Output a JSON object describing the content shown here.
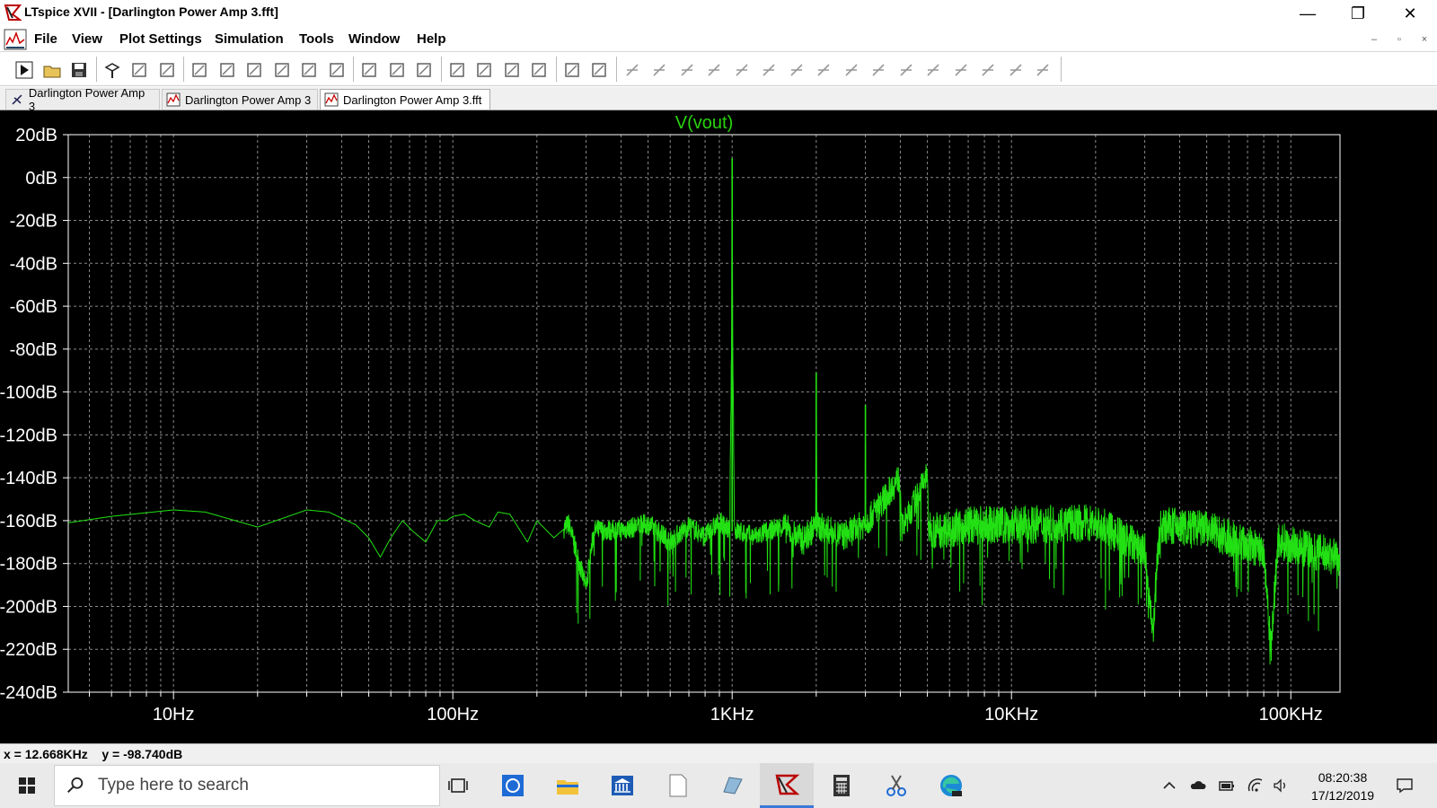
{
  "window": {
    "title": "LTspice XVII - [Darlington Power Amp 3.fft]",
    "buttons": {
      "minimize": "—",
      "maximize": "❐",
      "close": "✕"
    }
  },
  "menu": {
    "items": [
      "File",
      "View",
      "Plot Settings",
      "Simulation",
      "Tools",
      "Window",
      "Help"
    ],
    "mdi_buttons": {
      "minimize": "–",
      "restore": "▫",
      "close": "×"
    }
  },
  "toolbar": {
    "icons": [
      "run-icon",
      "open-icon",
      "save-icon",
      "control-panel-icon",
      "halt-icon",
      "pan-icon",
      "zoom-in-icon",
      "zoom-full-icon",
      "zoom-out-icon",
      "zoom-cancel-icon",
      "autorange-icon",
      "manual-limits-icon",
      "tile-horizontal-icon",
      "cascade-icon",
      "tile-vertical-icon",
      "cut-icon",
      "copy-icon",
      "paste-icon",
      "find-icon",
      "print-icon",
      "print-preview-icon",
      "draw-wire-icon",
      "ground-icon",
      "label-net-icon",
      "resistor-icon",
      "capacitor-icon",
      "inductor-icon",
      "diode-icon",
      "component-icon",
      "move-icon",
      "drag-icon",
      "undo-icon",
      "redo-icon",
      "rotate-icon",
      "mirror-icon",
      "text-icon",
      "spice-directive-icon"
    ]
  },
  "tabs": [
    {
      "label": "Darlington Power Amp 3",
      "icon": "schematic-icon",
      "active": false
    },
    {
      "label": "Darlington Power Amp 3",
      "icon": "waveform-icon",
      "active": false
    },
    {
      "label": "Darlington Power Amp 3.fft",
      "icon": "waveform-icon",
      "active": true
    }
  ],
  "plot": {
    "background": "#000000",
    "trace_color": "#22e013",
    "grid_color": "#8a8a8a"
  },
  "chart_data": {
    "type": "line",
    "title": "V(vout)",
    "xlabel": "",
    "ylabel": "",
    "x_scale": "log",
    "xlim": [
      4.2,
      150000
    ],
    "ylim": [
      -240,
      20
    ],
    "grid": true,
    "x_ticks": [
      {
        "value": 10,
        "label": "10Hz"
      },
      {
        "value": 100,
        "label": "100Hz"
      },
      {
        "value": 1000,
        "label": "1KHz"
      },
      {
        "value": 10000,
        "label": "10KHz"
      },
      {
        "value": 100000,
        "label": "100KHz"
      }
    ],
    "y_ticks": [
      {
        "value": 20,
        "label": "20dB"
      },
      {
        "value": 0,
        "label": "0dB"
      },
      {
        "value": -20,
        "label": "-20dB"
      },
      {
        "value": -40,
        "label": "-40dB"
      },
      {
        "value": -60,
        "label": "-60dB"
      },
      {
        "value": -80,
        "label": "-80dB"
      },
      {
        "value": -100,
        "label": "-100dB"
      },
      {
        "value": -120,
        "label": "-120dB"
      },
      {
        "value": -140,
        "label": "-140dB"
      },
      {
        "value": -160,
        "label": "-160dB"
      },
      {
        "value": -180,
        "label": "-180dB"
      },
      {
        "value": -200,
        "label": "-200dB"
      },
      {
        "value": -220,
        "label": "-220dB"
      },
      {
        "value": -240,
        "label": "-240dB"
      }
    ],
    "series": [
      {
        "name": "V(vout)",
        "points": [
          [
            4.2,
            -161
          ],
          [
            6,
            -158
          ],
          [
            10,
            -155
          ],
          [
            13,
            -156
          ],
          [
            20,
            -163
          ],
          [
            30,
            -155
          ],
          [
            36,
            -156
          ],
          [
            45,
            -162
          ],
          [
            50,
            -168
          ],
          [
            55,
            -177
          ],
          [
            60,
            -168
          ],
          [
            66,
            -160
          ],
          [
            72,
            -165
          ],
          [
            80,
            -170
          ],
          [
            88,
            -160
          ],
          [
            95,
            -160
          ],
          [
            100,
            -158
          ],
          [
            110,
            -157
          ],
          [
            120,
            -160
          ],
          [
            135,
            -163
          ],
          [
            145,
            -156
          ],
          [
            160,
            -157
          ],
          [
            175,
            -165
          ],
          [
            185,
            -170
          ],
          [
            200,
            -160
          ],
          [
            230,
            -168
          ],
          [
            260,
            -162
          ],
          [
            300,
            -192
          ],
          [
            320,
            -165
          ],
          [
            400,
            -165
          ],
          [
            500,
            -162
          ],
          [
            600,
            -170
          ],
          [
            700,
            -163
          ],
          [
            800,
            -168
          ],
          [
            900,
            -161
          ],
          [
            980,
            -165
          ],
          [
            995,
            -80
          ],
          [
            1000,
            9
          ],
          [
            1005,
            -80
          ],
          [
            1020,
            -165
          ],
          [
            1200,
            -168
          ],
          [
            1500,
            -163
          ],
          [
            1800,
            -170
          ],
          [
            1990,
            -163
          ],
          [
            2000,
            -91
          ],
          [
            2010,
            -163
          ],
          [
            2500,
            -168
          ],
          [
            2990,
            -162
          ],
          [
            3000,
            -106
          ],
          [
            3010,
            -162
          ],
          [
            4000,
            -140
          ],
          [
            4050,
            -165
          ],
          [
            5000,
            -139
          ],
          [
            5050,
            -166
          ],
          [
            7000,
            -163
          ],
          [
            10000,
            -163
          ],
          [
            20000,
            -162
          ],
          [
            30000,
            -175
          ],
          [
            32000,
            -215
          ],
          [
            34000,
            -163
          ],
          [
            50000,
            -165
          ],
          [
            80000,
            -175
          ],
          [
            85000,
            -220
          ],
          [
            90000,
            -170
          ],
          [
            120000,
            -175
          ],
          [
            150000,
            -178
          ]
        ],
        "noise_floor_band": "visible noise band around the trace from ~300 Hz upward"
      }
    ],
    "annotations": [
      {
        "type": "peak",
        "x": 1000,
        "y": 9,
        "label": ""
      },
      {
        "type": "peak",
        "x": 2000,
        "y": -91,
        "label": ""
      },
      {
        "type": "peak",
        "x": 3000,
        "y": -106,
        "label": ""
      }
    ]
  },
  "status": {
    "readout": "x = 12.668KHz    y = -98.740dB"
  },
  "taskbar": {
    "search_placeholder": "Type here to search",
    "apps": [
      "task-view-icon",
      "sync-app-icon",
      "file-explorer-icon",
      "bank-app-icon",
      "notepad-icon",
      "edge-beta-icon",
      "ltspice-icon",
      "calculator-icon",
      "snipping-tool-icon",
      "edge-dev-icon"
    ],
    "time": "08:20:38",
    "date": "17/12/2019"
  }
}
